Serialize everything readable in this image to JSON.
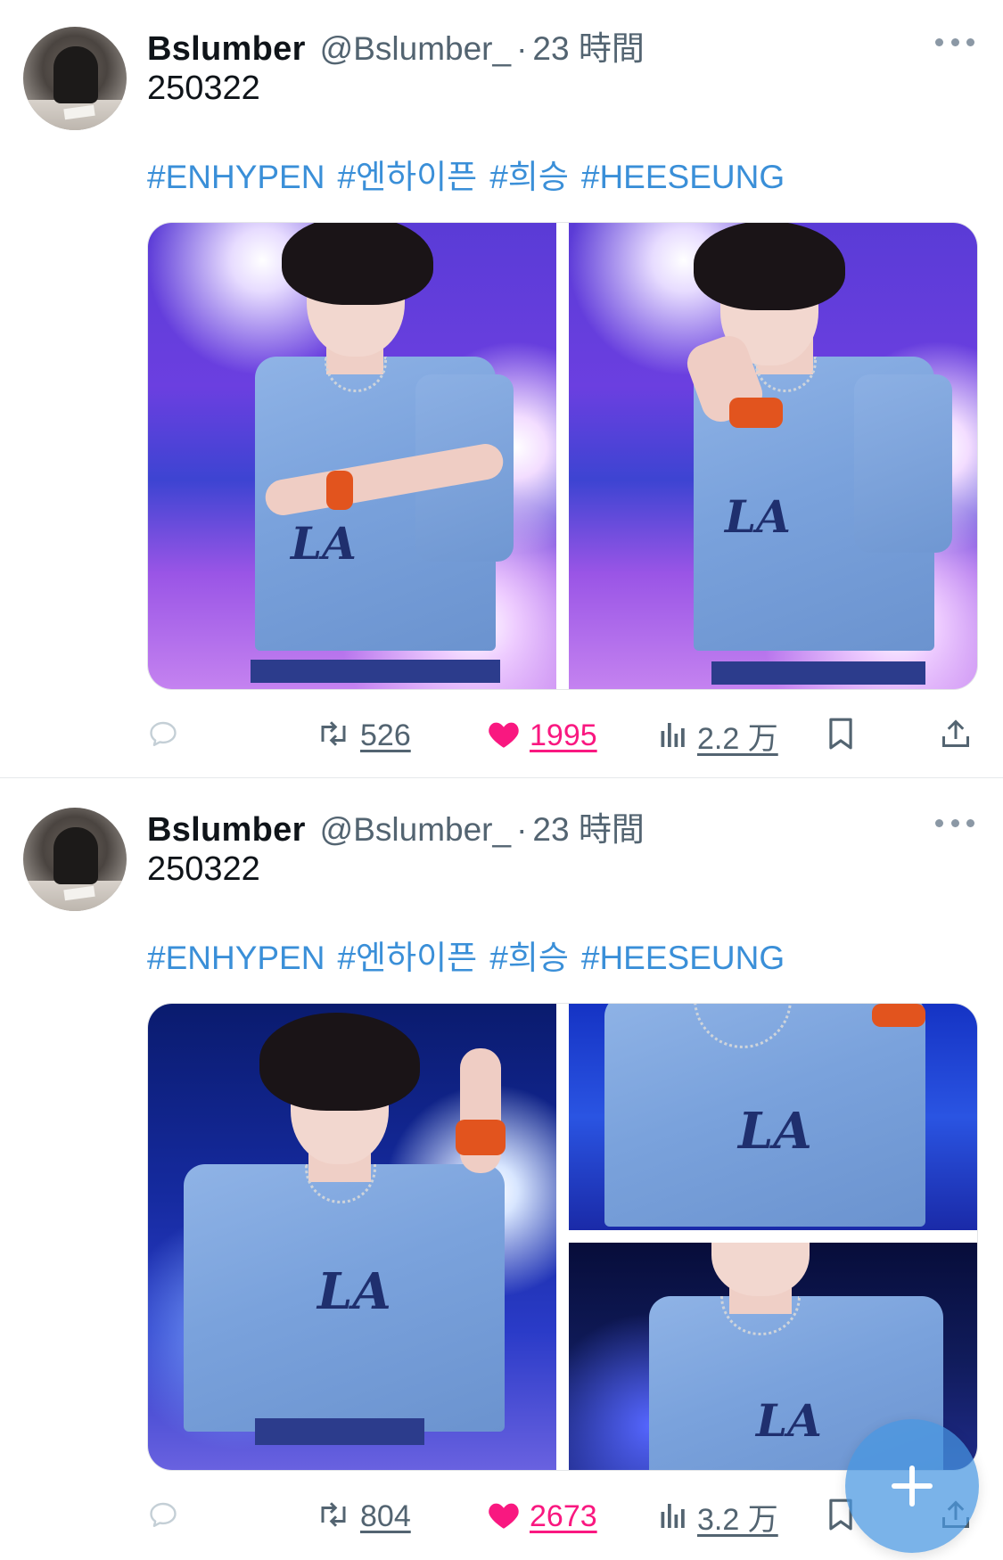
{
  "tweets": [
    {
      "display_name": "Bslumber",
      "handle": "@Bslumber_",
      "separator": "·",
      "time": "23 時間",
      "text": "250322",
      "hashtags": [
        "#ENHYPEN",
        "#엔하이픈",
        "#희승",
        "#HEESEUNG"
      ],
      "retweets": "526",
      "likes": "1995",
      "views": "2.2 万",
      "photos": 2
    },
    {
      "display_name": "Bslumber",
      "handle": "@Bslumber_",
      "separator": "·",
      "time": "23 時間",
      "text": "250322",
      "hashtags": [
        "#ENHYPEN",
        "#엔하이픈",
        "#희승",
        "#HEESEUNG"
      ],
      "retweets": "804",
      "likes": "2673",
      "views": "3.2 万",
      "photos": 3
    }
  ],
  "shirt_text": "LA",
  "icons": {
    "reply": "reply-icon",
    "retweet": "retweet-icon",
    "like": "heart-icon",
    "views": "views-icon",
    "bookmark": "bookmark-icon",
    "share": "share-icon",
    "more": "more-icon",
    "compose": "plus-icon"
  },
  "colors": {
    "text": "#0f1419",
    "secondary": "#536471",
    "hashtag": "#3a8fd8",
    "like": "#f91880",
    "fab": "#4696e1"
  }
}
